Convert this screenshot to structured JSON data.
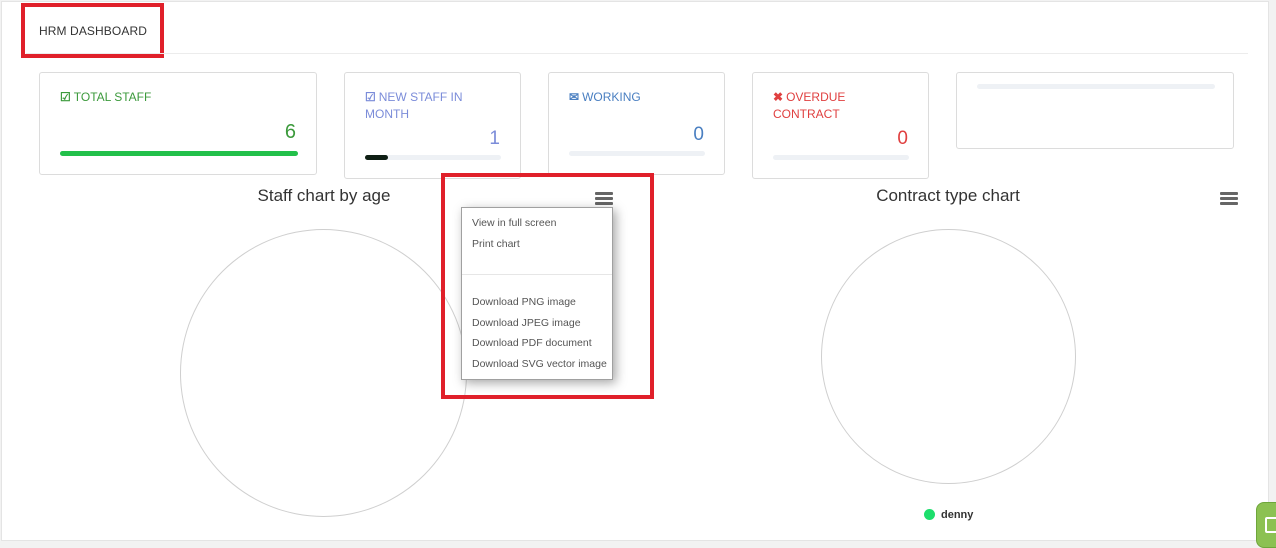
{
  "header": {
    "title": "HRM DASHBOARD"
  },
  "cards": [
    {
      "icon": "check-square-icon",
      "glyph": "☑",
      "label": "TOTAL STAFF",
      "value": "6",
      "progress": 1.0,
      "color": "#3c9a3c",
      "bar_color": "#22c04a"
    },
    {
      "icon": "edit-icon",
      "glyph": "☑",
      "label": "NEW STAFF IN MONTH",
      "value": "1",
      "progress": 0.17,
      "color": "#7b8cd9",
      "bar_color": "#0f1f14"
    },
    {
      "icon": "envelope-icon",
      "glyph": "✉",
      "label": "WORKING",
      "value": "0",
      "progress": 0,
      "color": "#4a7fc1",
      "bar_color": "#4a7fc1"
    },
    {
      "icon": "close-icon",
      "glyph": "✖",
      "label": "OVERDUE CONTRACT",
      "value": "0",
      "progress": 0,
      "color": "#e04040",
      "bar_color": "#e04040"
    }
  ],
  "charts": {
    "age": {
      "title": "Staff chart by age"
    },
    "contract": {
      "title": "Contract type chart",
      "legend": [
        {
          "name": "denny",
          "color": "#1dde6c"
        }
      ]
    }
  },
  "export_menu": {
    "items": [
      "View in full screen",
      "Print chart",
      "Download PNG image",
      "Download JPEG image",
      "Download PDF document",
      "Download SVG vector image"
    ]
  },
  "colors": {
    "highlight": "#e0202a"
  }
}
